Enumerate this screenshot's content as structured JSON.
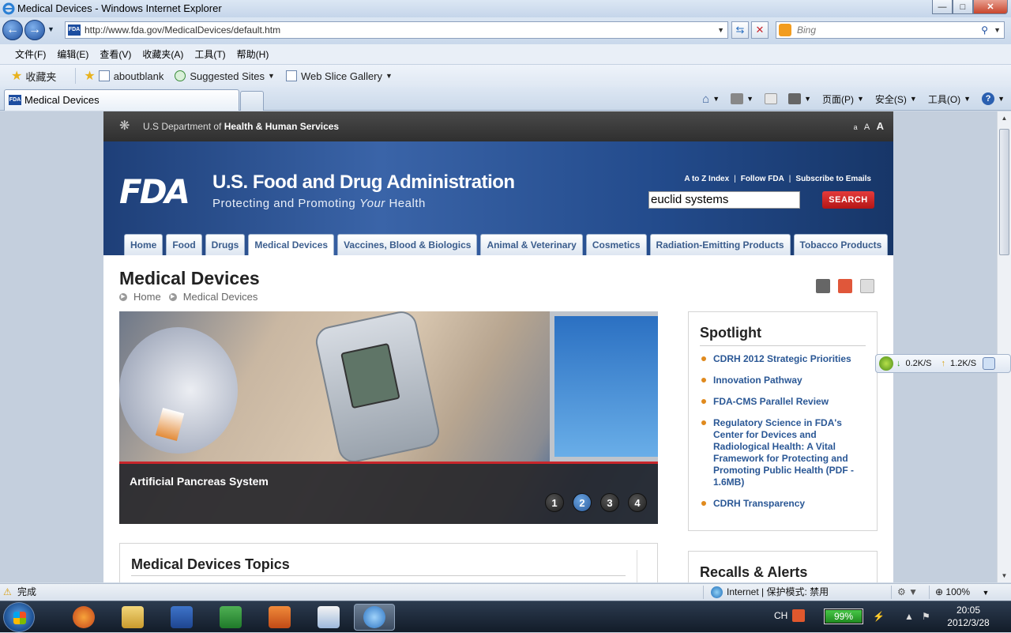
{
  "window": {
    "title": "Medical Devices - Windows Internet Explorer",
    "minimize": "—",
    "maximize": "□",
    "close": "✕"
  },
  "addressbar": {
    "url": "http://www.fda.gov/MedicalDevices/default.htm",
    "search_placeholder": "Bing"
  },
  "menubar": [
    "文件(F)",
    "编辑(E)",
    "查看(V)",
    "收藏夹(A)",
    "工具(T)",
    "帮助(H)"
  ],
  "favbar": {
    "favorites": "收藏夹",
    "items": [
      "aboutblank",
      "Suggested Sites",
      "Web Slice Gallery"
    ]
  },
  "tabs": {
    "active": "Medical Devices"
  },
  "commandbar": {
    "page": "页面(P)",
    "safety": "安全(S)",
    "tools": "工具(O)"
  },
  "fda": {
    "hhs_prefix": "U.S Department of ",
    "hhs_bold": "Health & Human Services",
    "text_sizes": [
      "a",
      "A",
      "A"
    ],
    "logo": "FDA",
    "agency": "U.S. Food and Drug Administration",
    "tagline_pre": "Protecting and Promoting ",
    "tagline_em": "Your",
    "tagline_post": " Health",
    "toplinks": [
      "A to Z Index",
      "Follow FDA",
      "Subscribe to Emails"
    ],
    "search_value": "euclid systems",
    "search_button": "SEARCH",
    "nav": [
      "Home",
      "Food",
      "Drugs",
      "Medical Devices",
      "Vaccines, Blood & Biologics",
      "Animal & Veterinary",
      "Cosmetics",
      "Radiation-Emitting Products",
      "Tobacco Products"
    ],
    "active_nav": "Medical Devices",
    "page_title": "Medical Devices",
    "breadcrumb": [
      "Home",
      "Medical Devices"
    ],
    "hero_caption": "Artificial Pancreas System",
    "slides": [
      "1",
      "2",
      "3",
      "4"
    ],
    "active_slide": "2",
    "topics_title": "Medical Devices Topics",
    "spotlight_title": "Spotlight",
    "spotlight_items": [
      "CDRH 2012 Strategic Priorities",
      "Innovation Pathway",
      "FDA-CMS Parallel Review",
      "Regulatory Science in FDA's Center for Devices and Radiological Health: A Vital Framework for Protecting and Promoting Public Health (PDF - 1.6MB)",
      "CDRH Transparency"
    ],
    "recalls_title": "Recalls & Alerts"
  },
  "netwidget": {
    "down": "0.2K/S",
    "up": "1.2K/S"
  },
  "statusbar": {
    "status": "完成",
    "zone": "Internet | 保护模式: 禁用",
    "zoom": "100%"
  },
  "taskbar": {
    "lang": "CH",
    "battery": "99%",
    "battery_level": 0.99,
    "time": "20:05",
    "date": "2012/3/28"
  },
  "colors": {
    "fda_blue": "#2a4f8f",
    "search_red": "#c91f1f",
    "bullet_orange": "#e08a1e",
    "link_blue": "#2a5795"
  }
}
